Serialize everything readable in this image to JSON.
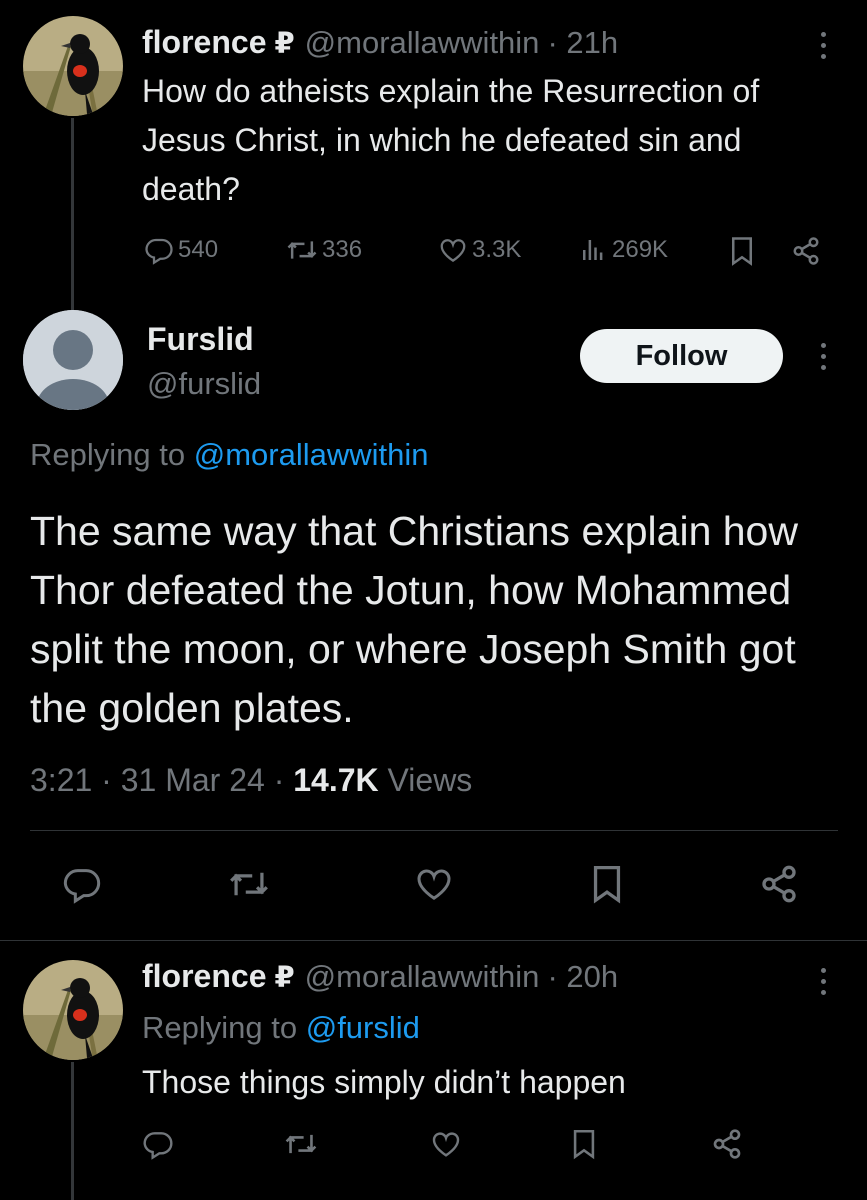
{
  "tweet1": {
    "name": "florence",
    "badge": "₽",
    "handle": "@morallawwithin",
    "time": "· 21h",
    "text": "How do atheists explain the Resurrection of Jesus Christ, in which he defeated sin and death?",
    "replies": "540",
    "reposts": "336",
    "likes": "3.3K",
    "views": "269K"
  },
  "main": {
    "name": "Furslid",
    "handle": "@furslid",
    "follow_label": "Follow",
    "replying_prefix": "Replying to",
    "replying_handle": "@morallawwithin",
    "text": "The same way that Christians explain how Thor defeated the Jotun, how Mohammed split the moon, or where Joseph Smith got the golden plates.",
    "time": "3:21",
    "date": "31 Mar 24",
    "views_count": "14.7K",
    "views_label": "Views"
  },
  "tweet3": {
    "name": "florence",
    "badge": "₽",
    "handle": "@morallawwithin",
    "time": "· 20h",
    "replying_prefix": "Replying to",
    "replying_handle": "@furslid",
    "text": "Those things simply didn’t happen"
  },
  "colors": {
    "background": "#000000",
    "text": "#e7e9ea",
    "muted": "#71767b",
    "link": "#1d9bf0"
  },
  "icons": [
    "reply-icon",
    "repost-icon",
    "like-icon",
    "views-icon",
    "bookmark-icon",
    "share-icon",
    "more-icon"
  ]
}
